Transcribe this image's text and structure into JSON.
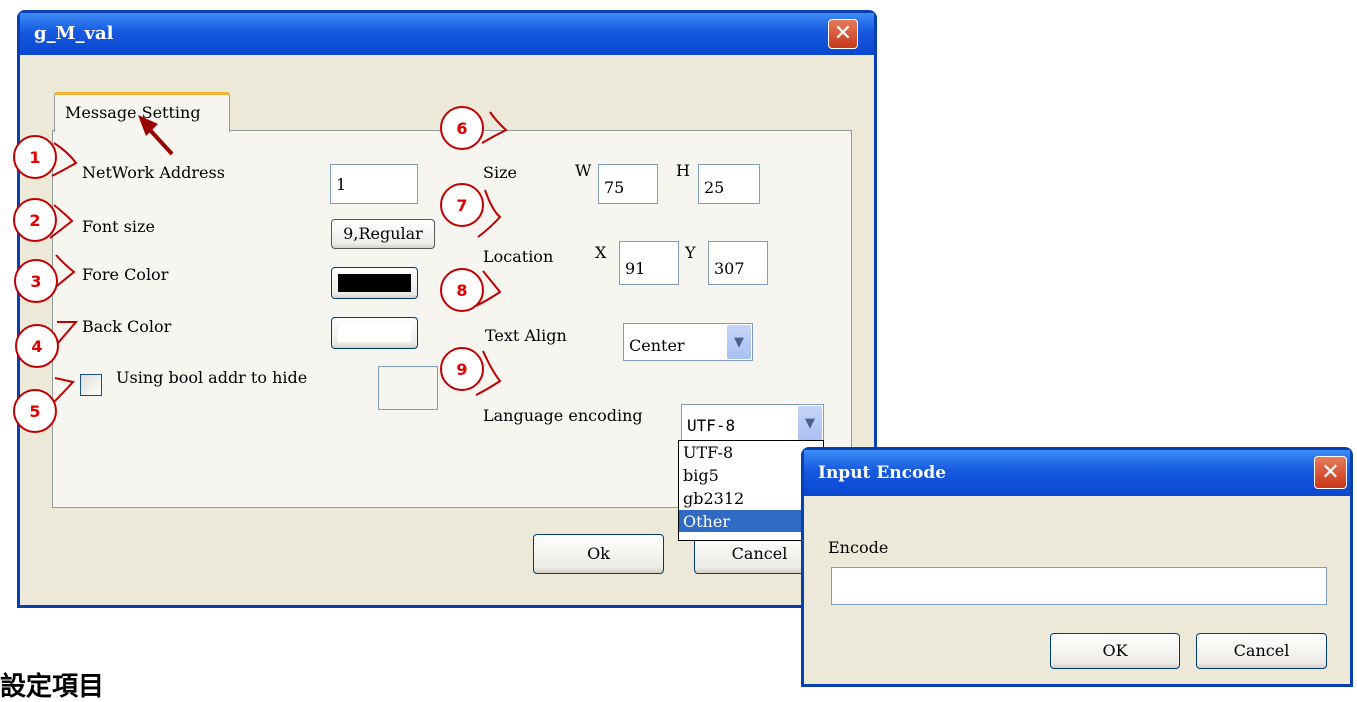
{
  "main_dialog": {
    "title": "g_M_val",
    "tab_label": "Message Setting",
    "network_address_label": "NetWork Address",
    "network_address_value": "1",
    "font_size_label": "Font size",
    "font_size_value": "9,Regular",
    "fore_color_label": "Fore Color",
    "back_color_label": "Back Color",
    "bool_hide_label": "Using bool addr to hide",
    "size_label": "Size",
    "w_label": "W",
    "w_value": "75",
    "h_label": "H",
    "h_value": "25",
    "location_label": "Location",
    "x_label": "X",
    "x_value": "91",
    "y_label": "Y",
    "y_value": "307",
    "text_align_label": "Text Align",
    "text_align_value": "Center",
    "language_encoding_label": "Language encoding",
    "language_encoding_value": "UTF-8",
    "encoding_options": [
      "UTF-8",
      "big5",
      "gb2312",
      "Other"
    ],
    "ok_label": "Ok",
    "cancel_label": "Cancel"
  },
  "input_encode_dialog": {
    "title": "Input Encode",
    "encode_label": "Encode",
    "encode_value": "",
    "ok_label": "OK",
    "cancel_label": "Cancel"
  },
  "callouts": [
    "1",
    "2",
    "3",
    "4",
    "5",
    "6",
    "7",
    "8",
    "9"
  ],
  "bottom_text": "設定項目",
  "colors": {
    "fore_color_swatch": "#000000",
    "back_color_swatch": "#ffffff",
    "callout_red": "#e00000",
    "selection_blue": "#316ac5"
  }
}
